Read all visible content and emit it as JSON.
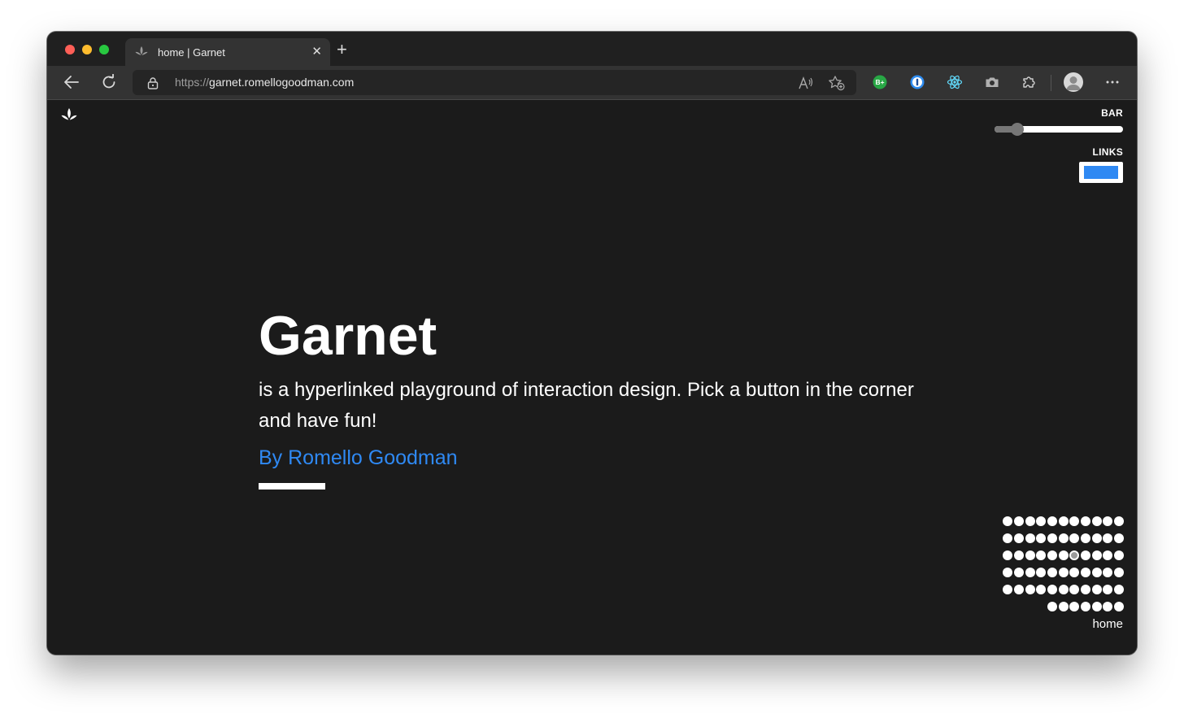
{
  "window": {
    "tab": {
      "title": "home | Garnet"
    },
    "address_bar": {
      "protocol": "https://",
      "host": "garnet.romellogoodman.com"
    },
    "extensions": [
      {
        "name": "bplus-extension-icon",
        "label": "B+",
        "color": "#28a745"
      },
      {
        "name": "password-manager-icon",
        "color": "#2e8cf0"
      },
      {
        "name": "react-devtools-icon",
        "color": "#61dafb"
      },
      {
        "name": "camera-icon",
        "color": "#b0b0b0"
      },
      {
        "name": "puzzle-extensions-icon",
        "color": "#d0d0d0"
      }
    ]
  },
  "controls": {
    "bar_label": "BAR",
    "bar_value": 0.18,
    "links_label": "LINKS",
    "links_color": "#2f89f3"
  },
  "hero": {
    "title": "Garnet",
    "description": "is a hyperlinked playground of interaction design. Pick a button in the corner and have fun!",
    "author_link": "By Romello Goodman",
    "accent_color": "#2f89f3"
  },
  "dot_grid": {
    "count": 62,
    "active_index": 28
  },
  "page_label": "home"
}
